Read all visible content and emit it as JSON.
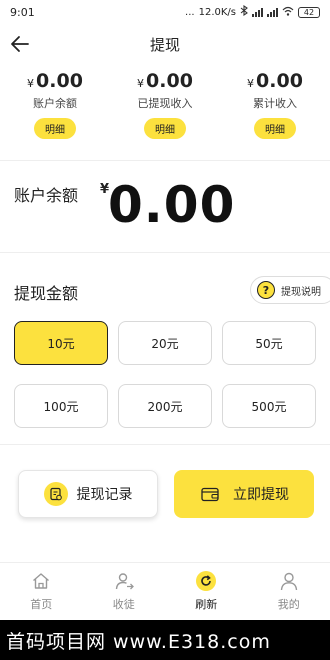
{
  "status_bar": {
    "time": "9:01",
    "net_speed": "12.0K/s",
    "dots": "...",
    "battery": "42"
  },
  "header": {
    "title": "提现"
  },
  "currency_symbol": "¥",
  "stats": [
    {
      "amount": "0.00",
      "label": "账户余额",
      "detail": "明细"
    },
    {
      "amount": "0.00",
      "label": "已提现收入",
      "detail": "明细"
    },
    {
      "amount": "0.00",
      "label": "累计收入",
      "detail": "明细"
    }
  ],
  "balance": {
    "label": "账户余额",
    "value": "0.00"
  },
  "withdraw": {
    "title": "提现金额",
    "explain": "提现说明",
    "explain_icon": "?",
    "options": [
      "10元",
      "20元",
      "50元",
      "100元",
      "200元",
      "500元"
    ],
    "selected": "10元"
  },
  "actions": {
    "records": "提现记录",
    "withdraw_now": "立即提现"
  },
  "tabs": [
    {
      "label": "首页",
      "icon": "home-icon"
    },
    {
      "label": "收徒",
      "icon": "add-user-icon"
    },
    {
      "label": "刷新",
      "icon": "refresh-icon",
      "active": true
    },
    {
      "label": "我的",
      "icon": "profile-icon"
    }
  ],
  "watermark": "首码项目网 www.E318.com",
  "colors": {
    "accent": "#FCE13E",
    "text": "#222222",
    "muted": "#888888"
  }
}
